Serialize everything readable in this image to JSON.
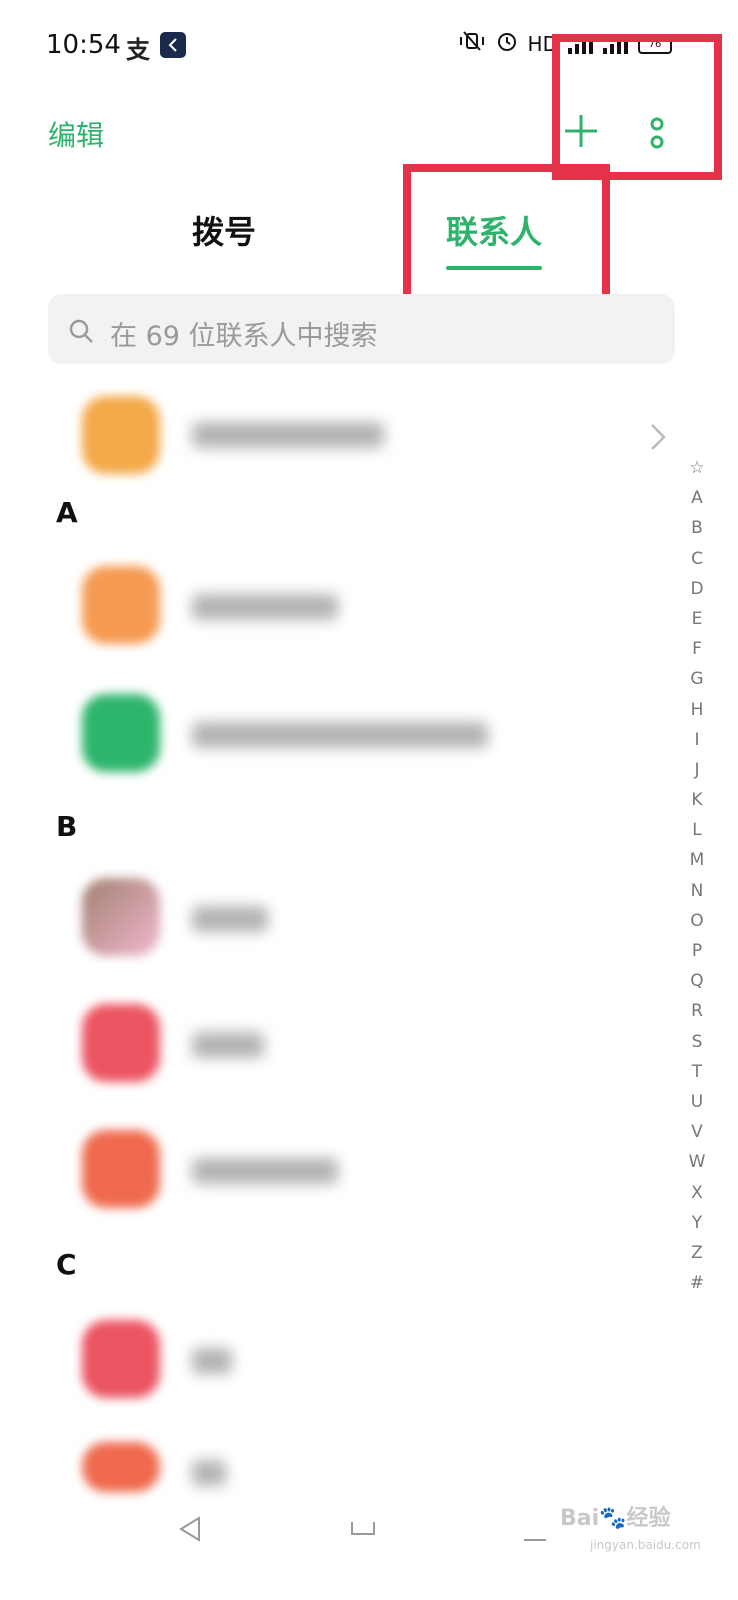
{
  "status_bar": {
    "time": "10:54",
    "app_icons": [
      "alipay-icon",
      "app-badge-icon"
    ],
    "network_label": "HD",
    "battery_label": "76",
    "icons": [
      "vibrate-mute-icon",
      "alarm-icon",
      "signal-icon",
      "battery-icon"
    ]
  },
  "header": {
    "edit_label": "编辑",
    "add_icon": "plus-icon",
    "more_icon": "more-vertical-icon"
  },
  "tabs": [
    {
      "label": "拨号",
      "active": false
    },
    {
      "label": "联系人",
      "active": true
    }
  ],
  "search": {
    "placeholder": "在 69 位联系人中搜索"
  },
  "sections": [
    {
      "letter": "A"
    },
    {
      "letter": "B"
    },
    {
      "letter": "C"
    }
  ],
  "index_bar": [
    "☆",
    "A",
    "B",
    "C",
    "D",
    "E",
    "F",
    "G",
    "H",
    "I",
    "J",
    "K",
    "L",
    "M",
    "N",
    "O",
    "P",
    "Q",
    "R",
    "S",
    "T",
    "U",
    "V",
    "W",
    "X",
    "Y",
    "Z",
    "#"
  ],
  "colors": {
    "accent": "#2db36b",
    "highlight_box": "#e63248",
    "avatar_orange": "#f4a94a",
    "avatar_orange2": "#f59a52",
    "avatar_green": "#2eb56c",
    "avatar_red": "#ec5562",
    "avatar_coral": "#ef6a4e"
  },
  "watermark": {
    "brand": "Bai🐾经验",
    "url": "jingyan.baidu.com"
  }
}
